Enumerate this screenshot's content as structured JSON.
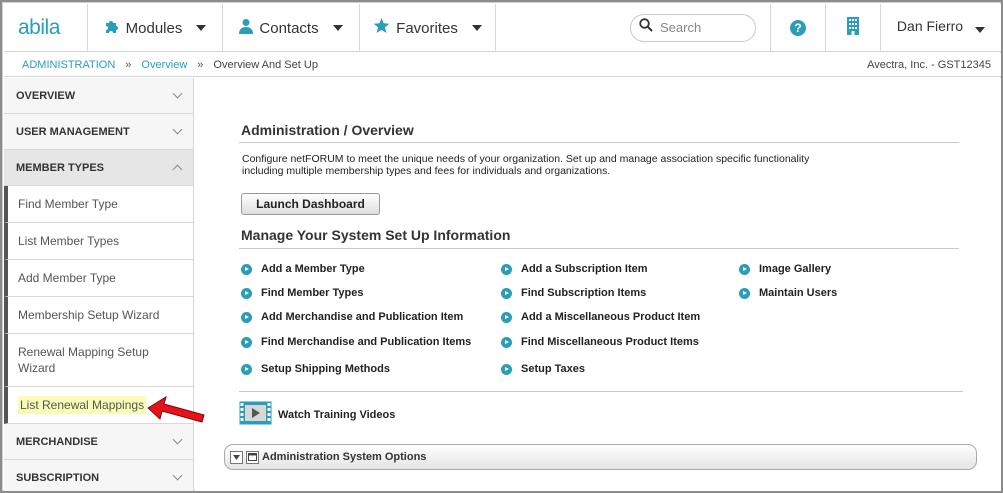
{
  "topnav": {
    "logo": "abila",
    "modules_label": "Modules",
    "contacts_label": "Contacts",
    "favorites_label": "Favorites",
    "search_placeholder": "Search",
    "user_name": "Dan Fierro",
    "accent_color": "#2a9db8"
  },
  "breadcrumb": {
    "items": [
      "ADMINISTRATION",
      "Overview"
    ],
    "separator": "»",
    "current": "Overview And Set Up",
    "org": "Avectra, Inc. - GST12345"
  },
  "sidebar": {
    "sections_top": [
      "OVERVIEW",
      "USER MANAGEMENT",
      "MEMBER TYPES"
    ],
    "items": [
      "Find Member Type",
      "List Member Types",
      "Add Member Type",
      "Membership Setup Wizard",
      "Renewal Mapping Setup Wizard",
      "List Renewal Mappings"
    ],
    "sections_bottom": [
      "MERCHANDISE",
      "SUBSCRIPTION"
    ]
  },
  "main": {
    "heading": "Administration / Overview",
    "description": "Configure netFORUM to meet the unique needs of your organization. Set up and manage association specific functionality including multiple membership types and fees for individuals and organizations.",
    "launch_label": "Launch Dashboard",
    "setup_heading": "Manage Your System Set Up Information",
    "links": {
      "col1": [
        "Add a Member Type",
        "Find Member Types",
        "Add Merchandise and Publication Item",
        "Find Merchandise and Publication Items",
        "Setup Shipping Methods"
      ],
      "col2": [
        "Add a Subscription Item",
        "Find Subscription Items",
        "Add a Miscellaneous Product Item",
        "Find Miscellaneous Product Items",
        "Setup Taxes"
      ],
      "col3": [
        "Image Gallery",
        "Maintain Users"
      ]
    },
    "training_label": "Watch Training Videos",
    "options_label": "Administration System Options"
  }
}
